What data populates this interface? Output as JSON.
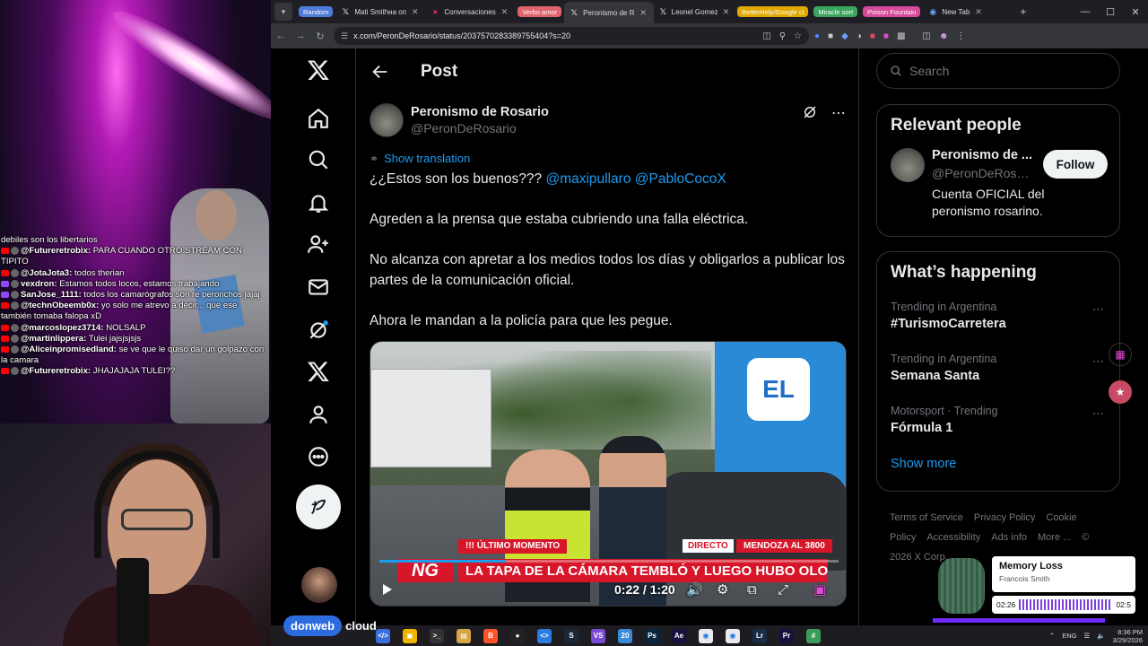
{
  "colors": {
    "accent": "#1d9bf0",
    "x_bg": "#000000",
    "tab_bar": "#1e1e24",
    "live_red": "#d7162a"
  },
  "browser": {
    "tabs": [
      {
        "label": "Random",
        "kind": "group",
        "color": "#4f7bd9"
      },
      {
        "label": "Mati Smithна оп",
        "kind": "tab",
        "icon": "x-logo-icon"
      },
      {
        "label": "Conversaciones",
        "kind": "tab",
        "icon": "chat-icon"
      },
      {
        "label": "Verbo amor",
        "kind": "group",
        "color": "#e0646d"
      },
      {
        "label": "Peronismo de R",
        "kind": "tab",
        "icon": "x-logo-icon",
        "active": true
      },
      {
        "label": "Leonel Gomez R",
        "kind": "tab",
        "icon": "x-logo-icon"
      },
      {
        "label": "BetterHelp/Google cl",
        "kind": "group",
        "color": "#e0a800"
      },
      {
        "label": "Miracle sort",
        "kind": "group",
        "color": "#3aa55d"
      },
      {
        "label": "Poison Fountain",
        "kind": "group",
        "color": "#d74a9c"
      },
      {
        "label": "New Tab",
        "kind": "tab",
        "icon": "chrome-icon"
      }
    ],
    "url": "x.com/PeronDeRosario/status/2037570283389755404?s=20"
  },
  "x": {
    "header": {
      "title": "Post"
    },
    "post": {
      "author_name": "Peronismo de Rosario",
      "author_handle": "@PeronDeRosario",
      "show_translation": "Show translation",
      "line1_prefix": "¿¿Estos son los buenos???",
      "mention1": "@maxipullaro",
      "mention2": "@PabloCocoX",
      "para2": "Agreden a la prensa que estaba cubriendo una falla eléctrica.",
      "para3": "No alcanza con apretar a los medios todos los días y obligarlos a publicar los partes de la comunicación oficial.",
      "para4": "Ahora le mandan a la policía para que les pegue."
    },
    "video": {
      "store_sign": "EL",
      "banner_tag": "!!! ÚLTIMO MOMENTO",
      "live_tag": "DIRECTO",
      "location": "MENDOZA AL 3800",
      "channel_logo": "NG",
      "headline": "LA TAPA DE LA CÁMARA TEMBLÓ Y LUEGO HUBO OLOR A QUEMADO",
      "time": "0:22 / 1:20",
      "progress": 0.275
    },
    "sidebar": {
      "search_placeholder": "Search",
      "relevant_title": "Relevant people",
      "relevant": {
        "name": "Peronismo de ...",
        "handle": "@PeronDeRosa...",
        "bio": "Cuenta OFICIAL del peronismo rosarino.",
        "follow": "Follow"
      },
      "happening_title": "What’s happening",
      "trends": [
        {
          "context": "Trending in Argentina",
          "name": "#TurismoCarretera"
        },
        {
          "context": "Trending in Argentina",
          "name": "Semana Santa"
        },
        {
          "context": "Motorsport · Trending",
          "name": "Fórmula 1"
        }
      ],
      "show_more": "Show more",
      "footer": [
        "Terms of Service",
        "Privacy Policy",
        "Cookie Policy",
        "Accessibility",
        "Ads info",
        "More ...",
        "© 2026 X Corp."
      ]
    }
  },
  "stream": {
    "chat": [
      {
        "user": "",
        "text": "debiles son los libertarios",
        "src": "none"
      },
      {
        "user": "@Futureretrobix:",
        "text": "PARA CUANDO OTRO STREAM CON TIPITO",
        "src": "yt",
        "wrap": true
      },
      {
        "user": "@JotaJota3:",
        "text": "todos therian",
        "src": "yt"
      },
      {
        "user": "vexdron:",
        "text": "Estamos todos locos, estamos trabajando",
        "src": "tw"
      },
      {
        "user": "SanJose_1111:",
        "text": "todos los camarógrafos son re peronchos jajaj",
        "src": "tw",
        "wrap": true
      },
      {
        "user": "@technObeemb0x:",
        "text": "yo solo me atrevo a decir... que ese también tomaba falopa xD",
        "src": "yt",
        "wrap": true
      },
      {
        "user": "@marcoslopez3714:",
        "text": "NOLSALP",
        "src": "yt"
      },
      {
        "user": "@martinlippera:",
        "text": "Tulei jajsjsjsjs",
        "src": "yt"
      },
      {
        "user": "@Aliceinpromisedland:",
        "text": "se ve que le quiso dar un golpazo con la camara",
        "src": "yt",
        "wrap": true
      },
      {
        "user": "@Futureretrobix:",
        "text": "JHAJAJAJA TULEI??",
        "src": "yt"
      }
    ],
    "sponsor_pill": "donweb",
    "sponsor_text": "cloud"
  },
  "music": {
    "title": "Memory Loss",
    "artist": "Francois Smith",
    "elapsed": "02:26",
    "total": "02:5",
    "progress": 0.85
  },
  "taskbar": {
    "lang": "ENG",
    "time": "8:36 PM",
    "date": "3/29/2026",
    "apps": [
      "Code",
      "Explorer",
      "Terminal",
      "Folder",
      "Brave",
      "OBS",
      "VS Code",
      "Steam",
      "Visual Studio",
      "Dev",
      "Photoshop",
      "After Effects",
      "Chrome",
      "Chrome",
      "Lightroom",
      "Premiere",
      "Slack"
    ]
  }
}
